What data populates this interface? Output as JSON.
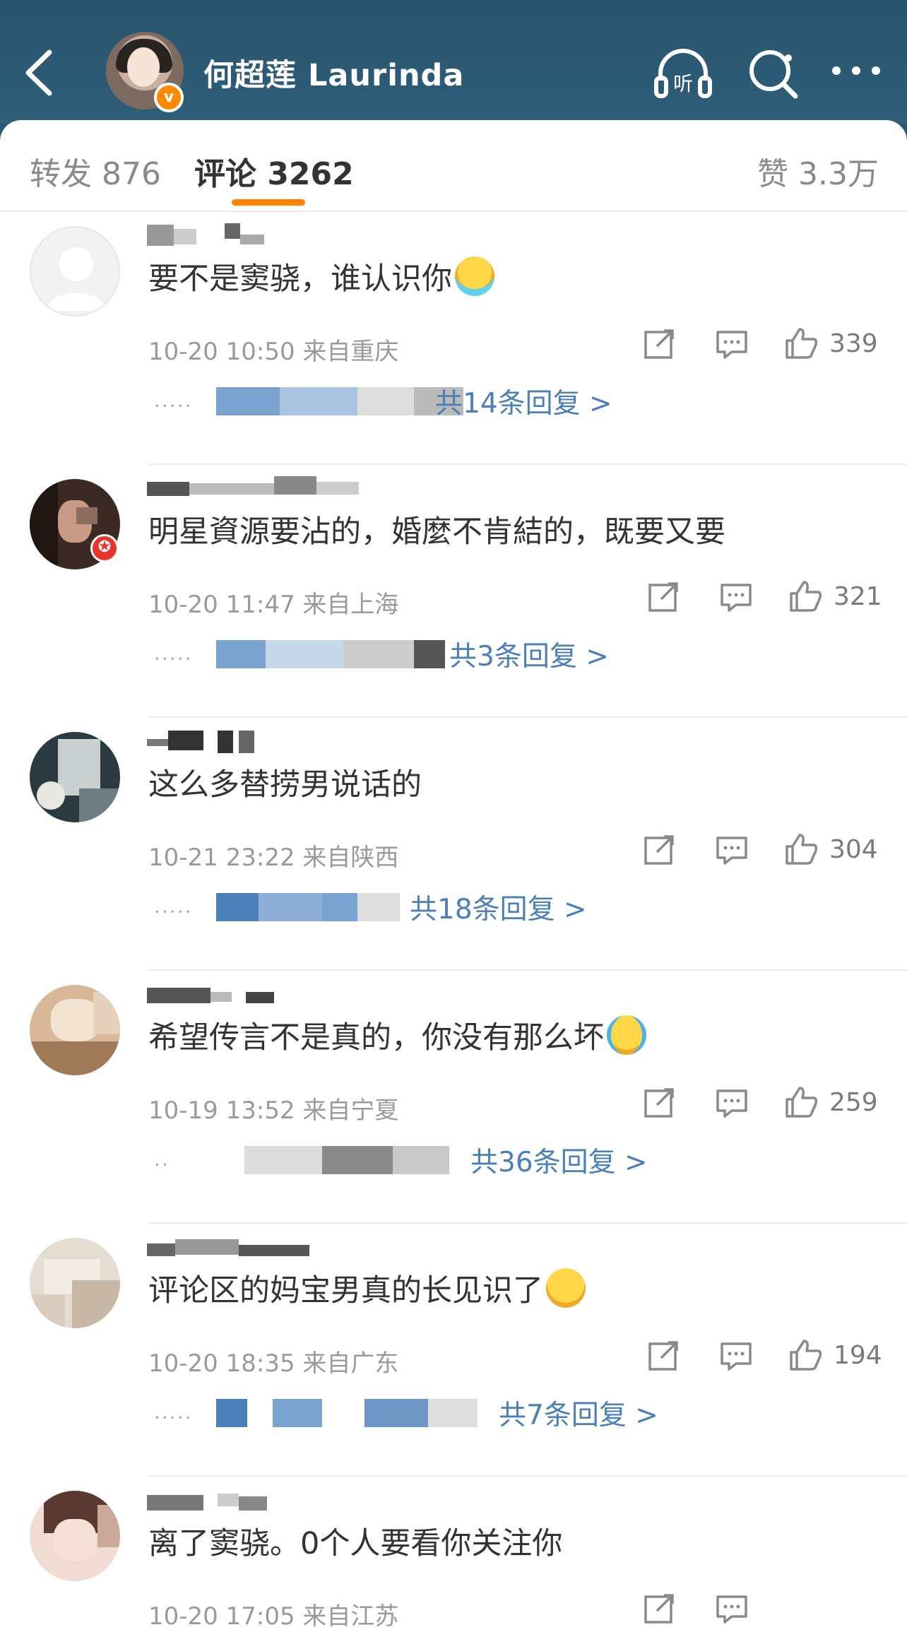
{
  "header": {
    "title": "何超莲 Laurinda",
    "verified_badge": "v",
    "listen_label": "听"
  },
  "tabs": {
    "repost": "转发 876",
    "comment": "评论 3262",
    "like": "赞 3.3万"
  },
  "comments": [
    {
      "text": "要不是窦骁，谁认识你",
      "emoji": "vomit-face",
      "meta": "10-20 10:50 来自重庆",
      "likes": "339",
      "replies": "共14条回复 >"
    },
    {
      "text": "明星資源要沾的，婚麼不肯結的，既要又要",
      "emoji": "",
      "meta": "10-20 11:47 来自上海",
      "likes": "321",
      "replies": "共3条回复 >"
    },
    {
      "text": "这么多替捞男说话的",
      "emoji": "",
      "meta": "10-21 23:22 来自陕西",
      "likes": "304",
      "replies": "共18条回复 >"
    },
    {
      "text": "希望传言不是真的，你没有那么坏",
      "emoji": "crying-face",
      "meta": "10-19 13:52 来自宁夏",
      "likes": "259",
      "replies": "共36条回复 >"
    },
    {
      "text": "评论区的妈宝男真的长见识了",
      "emoji": "smirk-face",
      "meta": "10-20 18:35 来自广东",
      "likes": "194",
      "replies": "共7条回复 >"
    },
    {
      "text": "离了窦骁。0个人要看你关注你",
      "emoji": "",
      "meta": "10-20 17:05 来自江苏",
      "likes": "",
      "replies": ""
    }
  ],
  "colors": {
    "header": "#2d5872",
    "accent": "#ff8200",
    "link": "#4a7fb8"
  }
}
